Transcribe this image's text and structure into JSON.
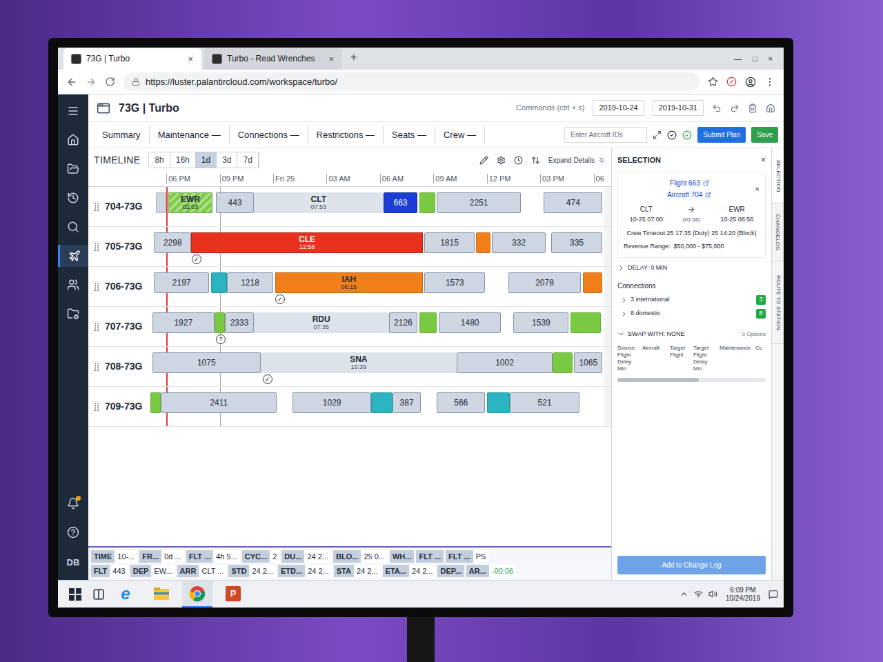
{
  "browser": {
    "tabs": [
      {
        "label": "73G | Turbo",
        "close": "×",
        "selected": true
      },
      {
        "label": "Turbo - Read Wrenches",
        "close": "×",
        "selected": false
      }
    ],
    "new_tab": "+",
    "window_controls": [
      "—",
      "□",
      "×"
    ],
    "url": "https://luster.palantircloud.com/workspace/turbo/"
  },
  "nav": {
    "items": [
      {
        "selected": false,
        "badge": false
      },
      {
        "selected": false,
        "badge": false
      },
      {
        "selected": false,
        "badge": false
      },
      {
        "selected": false,
        "badge": false
      },
      {
        "selected": false,
        "badge": false
      },
      {
        "selected": true,
        "badge": false
      },
      {
        "selected": false,
        "badge": false
      },
      {
        "selected": false,
        "badge": false
      },
      {
        "selected": false,
        "badge": true
      },
      {
        "selected": false,
        "badge": false
      }
    ],
    "user": "DB"
  },
  "app": {
    "title": "73G | Turbo",
    "commands_hint": "Commands (ctrl + s)",
    "date_from": "2019-10-24",
    "date_to": "2019-10-31",
    "tabs": [
      {
        "label": "Summary",
        "selected": false
      },
      {
        "label": "Maintenance —",
        "selected": false
      },
      {
        "label": "Connections —",
        "selected": false
      },
      {
        "label": "Restrictions —",
        "selected": false
      },
      {
        "label": "Seats —",
        "selected": false
      },
      {
        "label": "Crew —",
        "selected": false
      }
    ],
    "aircraft_input": {
      "placeholder": "Enter Aircraft IDs"
    },
    "buttons": [
      {
        "label": "Submit Plan",
        "color": "#1f6fe0"
      },
      {
        "label": "Save",
        "color": "#2e9e4f"
      }
    ]
  },
  "timeline": {
    "title": "TIMELINE",
    "zooms": [
      {
        "label": "8h",
        "selected": false
      },
      {
        "label": "16h",
        "selected": false
      },
      {
        "label": "1d",
        "selected": true
      },
      {
        "label": "3d",
        "selected": false
      },
      {
        "label": "7d",
        "selected": false
      }
    ],
    "expand": "Expand Details",
    "axis": {
      "start": -0.9,
      "end": 24.6,
      "ticks": [
        {
          "label": "06 PM",
          "at": 0
        },
        {
          "label": "09 PM",
          "at": 3
        },
        {
          "label": "Fri 25",
          "at": 6
        },
        {
          "label": "03 AM",
          "at": 9
        },
        {
          "label": "06 AM",
          "at": 12
        },
        {
          "label": "09 AM",
          "at": 15
        },
        {
          "label": "12 PM",
          "at": 18
        },
        {
          "label": "03 PM",
          "at": 21
        },
        {
          "label": "06",
          "at": 24
        }
      ]
    },
    "now": 0,
    "cursor": 3,
    "rows": [
      {
        "aircraft": "704-73G",
        "markers": [],
        "segments": [
          {
            "kind": "block",
            "start": -0.6,
            "end": 0,
            "color": "#cdd6e1"
          },
          {
            "kind": "status",
            "station": "EWR",
            "duration": "02:03",
            "start": 0.1,
            "end": 2.6,
            "color": "#7ac943",
            "striped": true
          },
          {
            "kind": "flight",
            "label": "443",
            "start": 2.8,
            "end": 4.9,
            "selected": false
          },
          {
            "kind": "ground",
            "station": "CLT",
            "duration": "07:53",
            "start": 4.9,
            "end": 12.2
          },
          {
            "kind": "flight",
            "label": "663",
            "start": 12.2,
            "end": 14.1,
            "selected": true
          },
          {
            "kind": "block",
            "start": 14.2,
            "end": 15.1,
            "color": "#7ac943"
          },
          {
            "kind": "flight",
            "label": "2251",
            "start": 15.2,
            "end": 19.9,
            "selected": false
          },
          {
            "kind": "flight",
            "label": "474",
            "start": 21.2,
            "end": 24.5,
            "selected": false
          }
        ]
      },
      {
        "aircraft": "705-73G",
        "markers": [
          {
            "symbol": "✓",
            "at": 1.7
          }
        ],
        "segments": [
          {
            "kind": "flight",
            "label": "2298",
            "start": -0.7,
            "end": 1.4,
            "selected": false
          },
          {
            "kind": "status",
            "station": "CLE",
            "duration": "12:58",
            "start": 1.4,
            "end": 14.4,
            "color": "#e8321e",
            "striped": false
          },
          {
            "kind": "flight",
            "label": "1815",
            "start": 14.5,
            "end": 17.3,
            "selected": false
          },
          {
            "kind": "block",
            "start": 17.4,
            "end": 18.2,
            "color": "#f07f1a"
          },
          {
            "kind": "flight",
            "label": "332",
            "start": 18.3,
            "end": 21.3,
            "selected": false
          },
          {
            "kind": "flight",
            "label": "335",
            "start": 21.6,
            "end": 24.5,
            "selected": false
          }
        ]
      },
      {
        "aircraft": "706-73G",
        "markers": [
          {
            "symbol": "✓",
            "at": 6.4
          }
        ],
        "segments": [
          {
            "kind": "flight",
            "label": "2197",
            "start": -0.7,
            "end": 2.4,
            "selected": false
          },
          {
            "kind": "block",
            "start": 2.5,
            "end": 3.4,
            "color": "#2bb3c0"
          },
          {
            "kind": "flight",
            "label": "1218",
            "start": 3.4,
            "end": 6.0,
            "selected": false
          },
          {
            "kind": "status",
            "station": "IAH",
            "duration": "08:15",
            "start": 6.1,
            "end": 14.4,
            "color": "#f07f1a",
            "striped": false
          },
          {
            "kind": "flight",
            "label": "1573",
            "start": 14.5,
            "end": 17.9,
            "selected": false
          },
          {
            "kind": "flight",
            "label": "2078",
            "start": 19.2,
            "end": 23.3,
            "selected": false
          },
          {
            "kind": "block",
            "start": 23.4,
            "end": 24.5,
            "color": "#f07f1a"
          }
        ]
      },
      {
        "aircraft": "707-73G",
        "markers": [
          {
            "symbol": "?",
            "at": 3.05
          }
        ],
        "segments": [
          {
            "kind": "flight",
            "label": "1927",
            "start": -0.8,
            "end": 2.7,
            "selected": false
          },
          {
            "kind": "block",
            "start": 2.7,
            "end": 3.3,
            "color": "#7ac943"
          },
          {
            "kind": "flight",
            "label": "2333",
            "start": 3.3,
            "end": 4.9,
            "selected": false
          },
          {
            "kind": "ground",
            "station": "RDU",
            "duration": "07:35",
            "start": 4.9,
            "end": 12.5
          },
          {
            "kind": "flight",
            "label": "2126",
            "start": 12.5,
            "end": 14.1,
            "selected": false
          },
          {
            "kind": "block",
            "start": 14.2,
            "end": 15.2,
            "color": "#7ac943"
          },
          {
            "kind": "flight",
            "label": "1480",
            "start": 15.3,
            "end": 18.8,
            "selected": false
          },
          {
            "kind": "flight",
            "label": "1539",
            "start": 19.5,
            "end": 22.6,
            "selected": false
          },
          {
            "kind": "block",
            "start": 22.7,
            "end": 24.4,
            "color": "#7ac943"
          }
        ]
      },
      {
        "aircraft": "708-73G",
        "markers": [
          {
            "symbol": "✓",
            "at": 5.7
          }
        ],
        "segments": [
          {
            "kind": "flight",
            "label": "1075",
            "start": -0.8,
            "end": 5.3,
            "selected": false
          },
          {
            "kind": "ground",
            "station": "SNA",
            "duration": "10:39",
            "start": 5.3,
            "end": 16.3
          },
          {
            "kind": "flight",
            "label": "1002",
            "start": 16.3,
            "end": 21.7,
            "selected": false
          },
          {
            "kind": "block",
            "start": 21.7,
            "end": 22.8,
            "color": "#7ac943"
          },
          {
            "kind": "flight",
            "label": "1065",
            "start": 22.9,
            "end": 24.5,
            "selected": false
          }
        ]
      },
      {
        "aircraft": "709-73G",
        "markers": [],
        "segments": [
          {
            "kind": "block",
            "start": -0.9,
            "end": -0.3,
            "color": "#7ac943"
          },
          {
            "kind": "flight",
            "label": "2411",
            "start": -0.3,
            "end": 6.2,
            "selected": false
          },
          {
            "kind": "flight",
            "label": "1029",
            "start": 7.1,
            "end": 11.5,
            "selected": false
          },
          {
            "kind": "block",
            "start": 11.5,
            "end": 12.7,
            "color": "#2bb3c0"
          },
          {
            "kind": "flight",
            "label": "387",
            "start": 12.7,
            "end": 14.3,
            "selected": false
          },
          {
            "kind": "flight",
            "label": "566",
            "start": 15.2,
            "end": 17.9,
            "selected": false
          },
          {
            "kind": "block",
            "start": 18.0,
            "end": 19.3,
            "color": "#2bb3c0"
          },
          {
            "kind": "flight",
            "label": "521",
            "start": 19.3,
            "end": 23.2,
            "selected": false
          }
        ]
      }
    ]
  },
  "details": [
    [
      {
        "label": "TIME",
        "value": "10-..."
      },
      {
        "label": "FR...",
        "value": "0d ..."
      },
      {
        "label": "FLT ...",
        "value": "4h 5..."
      },
      {
        "label": "CYC...",
        "value": "2"
      },
      {
        "label": "DU...",
        "value": "24 2..."
      },
      {
        "label": "BLO...",
        "value": "25 0..."
      },
      {
        "label": "WH..."
      },
      {
        "label": "FLT ..."
      },
      {
        "label": "FLT ...",
        "value": "PS"
      }
    ],
    [
      {
        "label": "FLT",
        "value": "443"
      },
      {
        "label": "DEP",
        "value": "EW..."
      },
      {
        "label": "ARR",
        "value": "CLT ..."
      },
      {
        "label": "STD",
        "value": "24 2..."
      },
      {
        "label": "ETD...",
        "value": "24 2..."
      },
      {
        "label": "STA",
        "value": "24 2..."
      },
      {
        "label": "ETA...",
        "value": "24 2..."
      },
      {
        "label": "DEP..."
      },
      {
        "label": "AR...",
        "value": "-00:06",
        "color": "#2e9e4f"
      }
    ]
  ],
  "selection": {
    "title": "SELECTION",
    "close": "×",
    "flight_link": "Flight 663",
    "aircraft_link": "Aircraft 704",
    "clear": "×",
    "from": "CLT",
    "to": "EWR",
    "dep_time": "10-25 07:00",
    "block_time": "(01:56)",
    "arr_time": "10-25 08:56",
    "crew_timeout": "Crew Timeout:25 17:35 (Duty) 25 14:20 (Block)",
    "revenue": "Revenue Range:  $50,000 - $75,000",
    "delay": {
      "label": "DELAY: 0 MIN",
      "expanded": false
    },
    "connections": {
      "title": "Connections",
      "items": [
        {
          "label": "3 international",
          "count": "3",
          "expanded": false,
          "color": "#22a745"
        },
        {
          "label": "8 domestic",
          "count": "8",
          "expanded": false,
          "color": "#22a745"
        }
      ]
    },
    "swap": {
      "label": "SWAP WITH: NONE",
      "expanded": true,
      "options": "0 Options",
      "columns": [
        "Source Flight Delay Min",
        "Aircraft",
        "Target Flight",
        "Target Flight Delay Min",
        "Maintenance",
        "Cc"
      ]
    },
    "button": {
      "label": "Add to Change Log",
      "disabled": true
    },
    "side_tabs": [
      {
        "label": "SELECTION",
        "selected": true
      },
      {
        "label": "CHANGELOG",
        "selected": false
      },
      {
        "label": "ROUTE TO STATION",
        "selected": false
      }
    ]
  },
  "taskbar": {
    "apps": [
      {
        "kind": "ie",
        "glyph": "e",
        "selected": false
      },
      {
        "kind": "explorer",
        "selected": false
      },
      {
        "kind": "chrome",
        "selected": true
      },
      {
        "kind": "powerpoint",
        "glyph": "P",
        "selected": false
      }
    ],
    "time": "6:09 PM",
    "date": "10/24/2019"
  }
}
